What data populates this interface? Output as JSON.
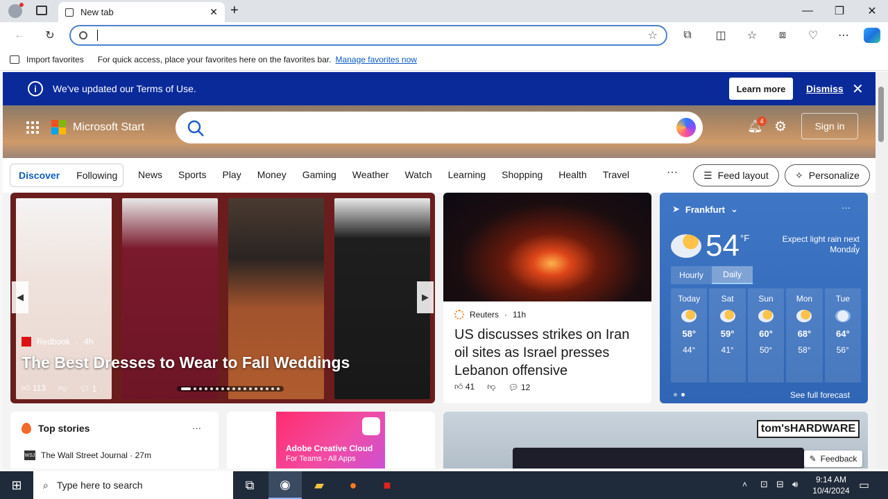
{
  "browser": {
    "tab_title": "New tab",
    "address_value": "",
    "fav_import": "Import favorites",
    "fav_hint": "For quick access, place your favorites here on the favorites bar.",
    "fav_manage": "Manage favorites now"
  },
  "notice": {
    "text": "We've updated our Terms of Use.",
    "learn_more": "Learn more",
    "dismiss": "Dismiss"
  },
  "header": {
    "brand": "Microsoft Start",
    "notif_count": "4",
    "signin": "Sign in"
  },
  "nav": {
    "discover": "Discover",
    "following": "Following",
    "items": [
      "News",
      "Sports",
      "Play",
      "Money",
      "Gaming",
      "Weather",
      "Watch",
      "Learning",
      "Shopping",
      "Health",
      "Travel"
    ],
    "more": "···",
    "feed_layout": "Feed layout",
    "personalize": "Personalize"
  },
  "hero": {
    "source": "Redbook",
    "age": "4h",
    "title": "The Best Dresses to Wear to Fall Weddings",
    "likes": "113",
    "comments": "1"
  },
  "news": {
    "source": "Reuters",
    "age": "11h",
    "title": "US discusses strikes on Iran oil sites as Israel presses Lebanon offensive",
    "likes": "41",
    "comments": "12"
  },
  "weather": {
    "location": "Frankfurt",
    "temp": "54",
    "unit": "°F",
    "note": "Expect light rain next Monday",
    "tab_hourly": "Hourly",
    "tab_daily": "Daily",
    "days": [
      {
        "name": "Today",
        "hi": "58°",
        "lo": "44°"
      },
      {
        "name": "Sat",
        "hi": "59°",
        "lo": "41°"
      },
      {
        "name": "Sun",
        "hi": "60°",
        "lo": "50°"
      },
      {
        "name": "Mon",
        "hi": "68°",
        "lo": "58°"
      },
      {
        "name": "Tue",
        "hi": "64°",
        "lo": "56°"
      }
    ],
    "forecast_link": "See full forecast"
  },
  "top_stories": {
    "title": "Top stories",
    "more": "···",
    "first_source": "The Wall Street Journal",
    "first_age": "27m"
  },
  "ad": {
    "line1": "Adobe Creative Cloud",
    "line2": "For Teams - All Apps"
  },
  "hardware": {
    "logo": "tom'sHARDWARE",
    "feedback": "Feedback"
  },
  "taskbar": {
    "search_placeholder": "Type here to search",
    "time": "9:14 AM",
    "date": "10/4/2024"
  },
  "colors": {
    "accent": "#0f5fbd",
    "notice_bg": "#0a2a9a",
    "weather_bg": "#3f77c6",
    "taskbar_bg": "#1f2a3a"
  }
}
